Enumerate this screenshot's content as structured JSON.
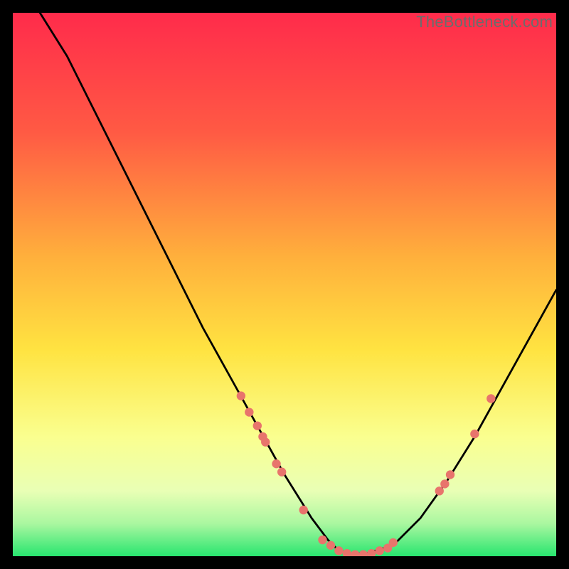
{
  "watermark": "TheBottleneck.com",
  "colors": {
    "black": "#000000",
    "curve": "#000000",
    "dot": "#e8746c",
    "gradient_top": "#ff2b4b",
    "gradient_mid1": "#ff8a3a",
    "gradient_mid2": "#ffe341",
    "gradient_mid3": "#faff8f",
    "gradient_mid4": "#d4ffb0",
    "gradient_bottom": "#28e56f"
  },
  "chart_data": {
    "type": "line",
    "title": "",
    "xlabel": "",
    "ylabel": "",
    "x_range": [
      0,
      100
    ],
    "y_range": [
      0,
      100
    ],
    "series": [
      {
        "name": "bottleneck-curve",
        "x": [
          5,
          10,
          15,
          20,
          25,
          30,
          35,
          40,
          45,
          50,
          55,
          58,
          60,
          62,
          65,
          70,
          75,
          80,
          85,
          90,
          95,
          100
        ],
        "y": [
          100,
          92,
          82,
          72,
          62,
          52,
          42,
          33,
          24,
          15,
          7,
          3,
          1,
          0.5,
          0.5,
          2,
          7,
          14,
          22,
          31,
          40,
          49
        ]
      }
    ],
    "points": [
      {
        "name": "dot",
        "x": 42.0,
        "y": 29.5
      },
      {
        "name": "dot",
        "x": 43.5,
        "y": 26.5
      },
      {
        "name": "dot",
        "x": 45.0,
        "y": 24.0
      },
      {
        "name": "dot",
        "x": 46.0,
        "y": 22.0
      },
      {
        "name": "dot",
        "x": 46.5,
        "y": 21.0
      },
      {
        "name": "dot",
        "x": 48.5,
        "y": 17.0
      },
      {
        "name": "dot",
        "x": 49.5,
        "y": 15.5
      },
      {
        "name": "dot",
        "x": 53.5,
        "y": 8.5
      },
      {
        "name": "dot",
        "x": 57.0,
        "y": 3.0
      },
      {
        "name": "dot",
        "x": 58.5,
        "y": 2.0
      },
      {
        "name": "dot",
        "x": 60.0,
        "y": 1.0
      },
      {
        "name": "dot",
        "x": 61.5,
        "y": 0.5
      },
      {
        "name": "dot",
        "x": 63.0,
        "y": 0.3
      },
      {
        "name": "dot",
        "x": 64.5,
        "y": 0.3
      },
      {
        "name": "dot",
        "x": 66.0,
        "y": 0.5
      },
      {
        "name": "dot",
        "x": 67.5,
        "y": 1.0
      },
      {
        "name": "dot",
        "x": 69.0,
        "y": 1.5
      },
      {
        "name": "dot",
        "x": 70.0,
        "y": 2.5
      },
      {
        "name": "dot",
        "x": 78.5,
        "y": 12.0
      },
      {
        "name": "dot",
        "x": 79.5,
        "y": 13.3
      },
      {
        "name": "dot",
        "x": 80.5,
        "y": 15.0
      },
      {
        "name": "dot",
        "x": 85.0,
        "y": 22.5
      },
      {
        "name": "dot",
        "x": 88.0,
        "y": 29.0
      }
    ]
  }
}
